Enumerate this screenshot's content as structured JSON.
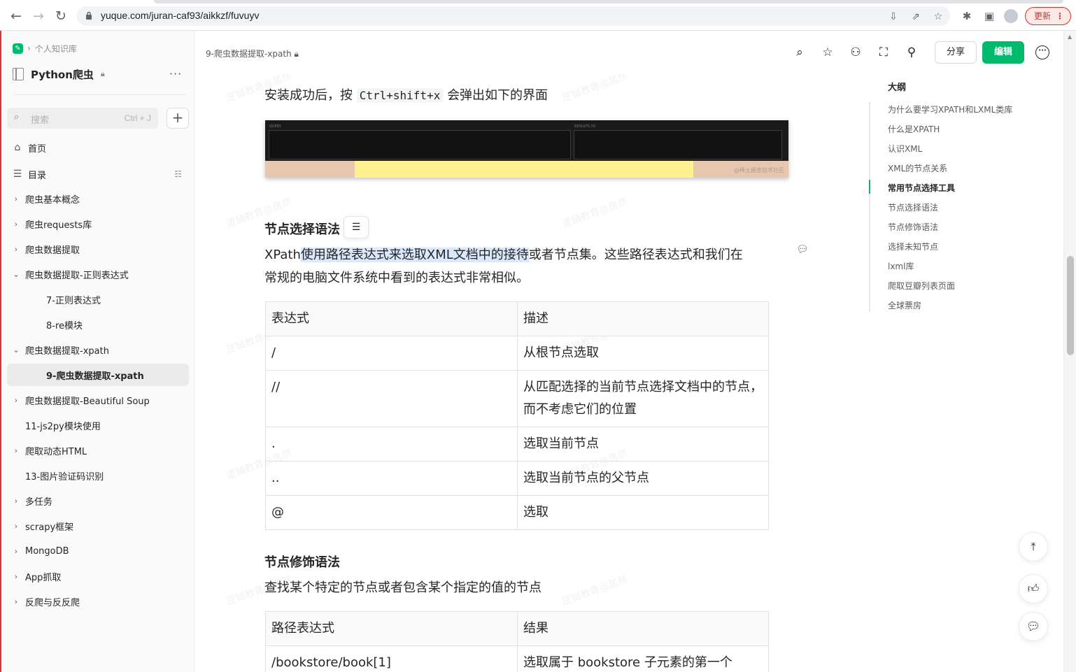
{
  "browser": {
    "url": "yuque.com/juran-caf93/aikkzf/fuvuyv",
    "update_label": "更新"
  },
  "sidebar": {
    "breadcrumb": "个人知识库",
    "kb_title": "Python爬虫",
    "search_placeholder": "搜索",
    "search_shortcut": "Ctrl + J",
    "nav": {
      "home": "首页",
      "toc": "目录"
    },
    "items": [
      {
        "label": "爬虫基本概念",
        "caret": "›"
      },
      {
        "label": "爬虫requests库",
        "caret": "›"
      },
      {
        "label": "爬虫数据提取",
        "caret": "›"
      },
      {
        "label": "爬虫数据提取-正则表达式",
        "caret": "⌄"
      },
      {
        "label": "7-正则表达式",
        "caret": ""
      },
      {
        "label": "8-re模块",
        "caret": ""
      },
      {
        "label": "爬虫数据提取-xpath",
        "caret": "⌄"
      },
      {
        "label": "9-爬虫数据提取-xpath",
        "caret": ""
      },
      {
        "label": "爬虫数据提取-Beautiful Soup",
        "caret": "›"
      },
      {
        "label": "11-js2py模块使用",
        "caret": ""
      },
      {
        "label": "爬取动态HTML",
        "caret": "›"
      },
      {
        "label": "13-图片验证码识别",
        "caret": ""
      },
      {
        "label": "多任务",
        "caret": "›"
      },
      {
        "label": "scrapy框架",
        "caret": "›"
      },
      {
        "label": "MongoDB",
        "caret": "›"
      },
      {
        "label": "App抓取",
        "caret": "›"
      },
      {
        "label": "反爬与反反爬",
        "caret": "›"
      }
    ]
  },
  "header": {
    "doc_crumb": "9-爬虫数据提取-xpath",
    "share_label": "分享",
    "edit_label": "编辑"
  },
  "doc": {
    "install_prefix": "安装成功后，按",
    "install_code": "Ctrl+shift+x",
    "install_suffix": "会弹出如下的界面",
    "screenshot": {
      "query_label": "QUERY",
      "results_label": "RESULTS (0)",
      "watermark": "@稀土掘金技术社区"
    },
    "section1_title": "节点选择语法",
    "para1_a": "XPath",
    "para1_b": "使用路径表达式来选取XML文档中的接待",
    "para1_c": "或者节点集。这些路径表达式和我们在",
    "para1_line2": "常规的电脑文件系统中看到的表达式非常相似。",
    "table1": {
      "headers": [
        "表达式",
        "描述"
      ],
      "rows": [
        [
          "/",
          "从根节点选取"
        ],
        [
          "//",
          "从匹配选择的当前节点选择文档中的节点，而不考虑它们的位置"
        ],
        [
          ".",
          "选取当前节点"
        ],
        [
          "..",
          "选取当前节点的父节点"
        ],
        [
          "@",
          "选取"
        ]
      ]
    },
    "section2_title": "节点修饰语法",
    "para2": "查找某个特定的节点或者包含某个指定的值的节点",
    "table2": {
      "headers": [
        "路径表达式",
        "结果"
      ],
      "rows": [
        [
          "/bookstore/book[1]",
          "选取属于 bookstore 子元素的第一个"
        ]
      ]
    },
    "watermark_text": "逻辑教育@居然"
  },
  "outline": {
    "title": "大纲",
    "items": [
      "为什么要学习XPATH和LXML类库",
      "什么是XPATH",
      "认识XML",
      "XML的节点关系",
      "常用节点选择工具",
      "节点选择语法",
      "节点修饰语法",
      "选择未知节点",
      "lxml库",
      "爬取豆瓣列表页面",
      "全球票房"
    ],
    "active_index": 4
  },
  "colors": {
    "brand": "#00b96b",
    "update": "#d93025"
  }
}
